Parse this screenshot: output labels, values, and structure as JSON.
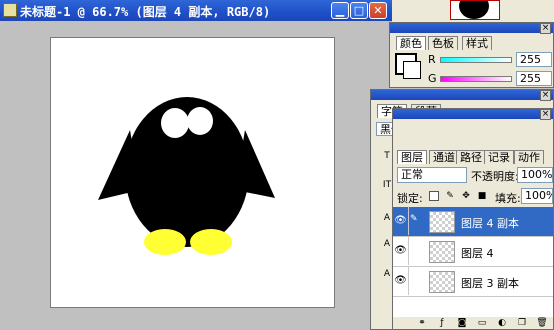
{
  "document": {
    "title": "未标题-1 @ 66.7% (图层 4 副本, RGB/8)",
    "minimize_glyph": "▁",
    "maximize_glyph": "□",
    "close_glyph": "✕"
  },
  "colors": {
    "title_bar": "#1f4fc6",
    "canvas_bg": "#ffffff",
    "penguin_body": "#000000",
    "penguin_feet": "#ffff33",
    "layer_selected": "#316ac5"
  },
  "color_palette": {
    "tabs": [
      "颜色",
      "色板",
      "样式"
    ],
    "r_label": "R",
    "r_value": "255",
    "g_label": "G",
    "g_value": "255"
  },
  "character_palette": {
    "tabs": [
      "字符",
      "段落"
    ],
    "font_family": "黑体",
    "font_style": "-",
    "side_labels": [
      "T",
      "IT",
      "A",
      "A",
      "A"
    ]
  },
  "layers_palette": {
    "tabs": [
      "图层",
      "通道",
      "路径",
      "记录",
      "动作"
    ],
    "blend_mode": "正常",
    "opacity_label": "不透明度:",
    "opacity_value": "100%",
    "lock_label": "锁定:",
    "fill_label": "填充:",
    "fill_value": "100%",
    "layers": [
      {
        "name": "图层 4 副本",
        "selected": true
      },
      {
        "name": "图层 4",
        "selected": false
      },
      {
        "name": "图层 3 副本",
        "selected": false
      }
    ],
    "footer_icons": [
      "link-icon",
      "style-icon",
      "mask-icon",
      "set-icon",
      "adjust-icon",
      "new-layer-icon",
      "trash-icon"
    ]
  }
}
